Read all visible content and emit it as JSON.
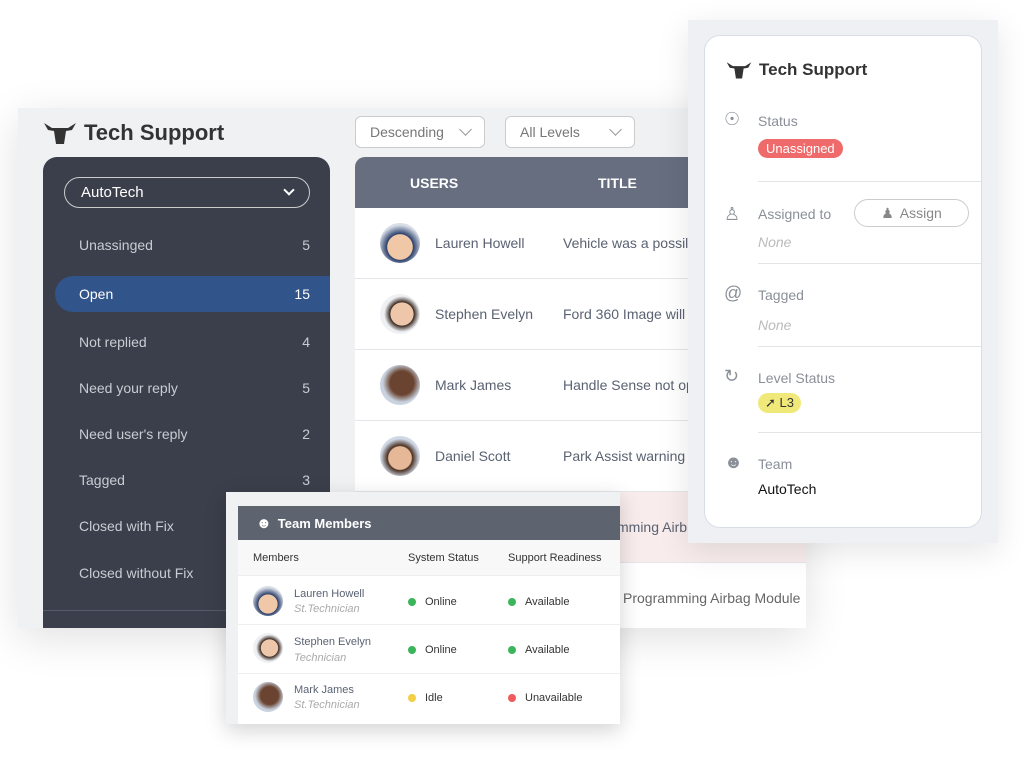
{
  "app": {
    "title": "Tech Support"
  },
  "filters": {
    "sort": "Descending",
    "level": "All Levels"
  },
  "sidebar": {
    "team": "AutoTech",
    "items": [
      {
        "label": "Unassinged",
        "count": "5"
      },
      {
        "label": "Open",
        "count": "15",
        "active": true
      },
      {
        "label": "Not replied",
        "count": "4"
      },
      {
        "label": "Need your reply",
        "count": "5"
      },
      {
        "label": "Need user's reply",
        "count": "2"
      },
      {
        "label": "Tagged",
        "count": "3"
      },
      {
        "label": "Closed with Fix",
        "count": ""
      },
      {
        "label": "Closed without Fix",
        "count": ""
      }
    ]
  },
  "table": {
    "headers": [
      "USERS",
      "TITLE"
    ],
    "rows": [
      {
        "user": "Lauren Howell",
        "title": "Vehicle was a possil"
      },
      {
        "user": "Stephen Evelyn",
        "title": "Ford 360 Image will"
      },
      {
        "user": "Mark James",
        "title": "Handle Sense not op"
      },
      {
        "user": "Daniel Scott",
        "title": "Park Assist warning"
      },
      {
        "user": "",
        "title": "mming Airb"
      },
      {
        "user": "",
        "title": "Programming Airbag Module"
      }
    ]
  },
  "team_members": {
    "title": "Team Members",
    "headers": [
      "Members",
      "System Status",
      "Support Readiness"
    ],
    "rows": [
      {
        "name": "Lauren Howell",
        "role": "St.Technician",
        "status": "Online",
        "status_color": "#3cb55a",
        "readiness": "Available",
        "readiness_color": "#3cb55a"
      },
      {
        "name": "Stephen Evelyn",
        "role": "Technician",
        "status": "Online",
        "status_color": "#3cb55a",
        "readiness": "Available",
        "readiness_color": "#3cb55a"
      },
      {
        "name": "Mark James",
        "role": "St.Technician",
        "status": "Idle",
        "status_color": "#f2cf45",
        "readiness": "Unavailable",
        "readiness_color": "#f05a5a"
      }
    ]
  },
  "detail": {
    "title": "Tech Support",
    "status_label": "Status",
    "status": "Unassigned",
    "status_color": "#ef6a6a",
    "assigned_label": "Assigned to",
    "assign_button": "Assign",
    "assigned": "None",
    "tagged_label": "Tagged",
    "tagged": "None",
    "level_label": "Level Status",
    "level": "L3",
    "level_color": "#f0e97a",
    "team_label": "Team",
    "team": "AutoTech"
  }
}
